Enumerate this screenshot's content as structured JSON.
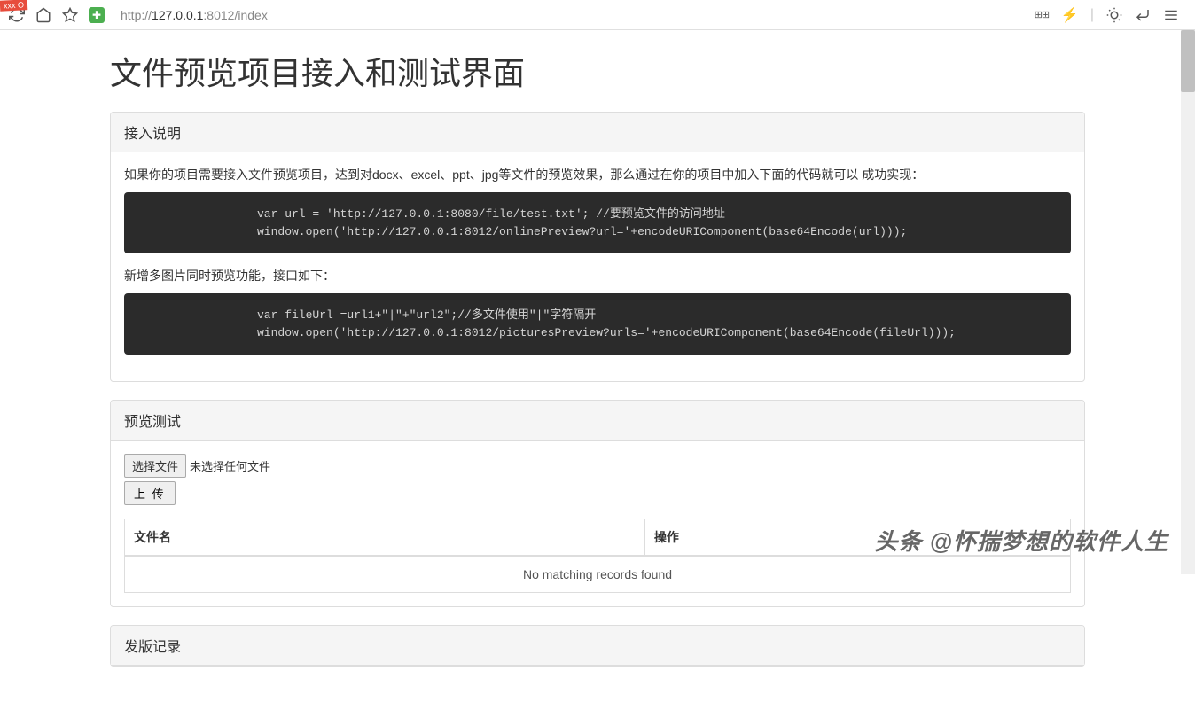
{
  "browser": {
    "url_prefix": "http://",
    "url_host": "127.0.0.1",
    "url_port_path": ":8012/index"
  },
  "page": {
    "title": "文件预览项目接入和测试界面"
  },
  "section1": {
    "heading": "接入说明",
    "desc1": "如果你的项目需要接入文件预览项目，达到对docx、excel、ppt、jpg等文件的预览效果，那么通过在你的项目中加入下面的代码就可以 成功实现：",
    "code1": "var url = 'http://127.0.0.1:8080/file/test.txt'; //要预览文件的访问地址\nwindow.open('http://127.0.0.1:8012/onlinePreview?url='+encodeURIComponent(base64Encode(url)));\n",
    "desc2": "新增多图片同时预览功能，接口如下：",
    "code2": "var fileUrl =url1+\"|\"+\"url2\";//多文件使用\"|\"字符隔开\nwindow.open('http://127.0.0.1:8012/picturesPreview?urls='+encodeURIComponent(base64Encode(fileUrl)));\n"
  },
  "section2": {
    "heading": "预览测试",
    "choose_file": "选择文件",
    "no_file": "未选择任何文件",
    "upload": "上 传",
    "table": {
      "col1": "文件名",
      "col2": "操作",
      "empty": "No matching records found"
    }
  },
  "section3": {
    "heading": "发版记录"
  },
  "watermark": "头条 @怀揣梦想的软件人生"
}
